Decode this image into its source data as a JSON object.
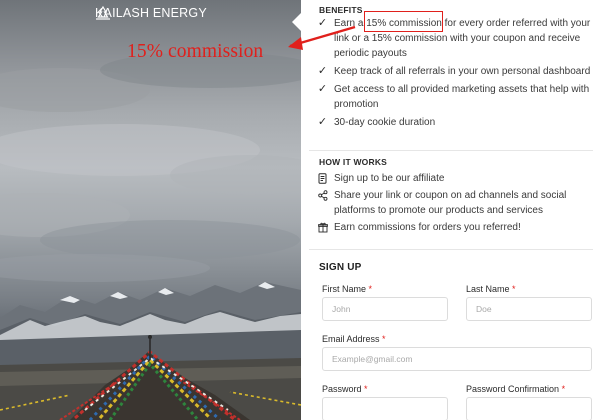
{
  "brand": {
    "name": "KAILASH ENERGY"
  },
  "annotation": {
    "label": "15% commission",
    "color": "#e0201c"
  },
  "benefits": {
    "heading": "BENEFITS",
    "items": [
      {
        "icon": "checkmark-icon",
        "line1_prefix": "Earn a ",
        "line1_highlight": "15% commission",
        "line1_suffix": " for every order referred with",
        "rest": "your link or a 15% commission with your coupon and receive periodic payouts"
      },
      {
        "icon": "checkmark-icon",
        "text": "Keep track of all referrals in your own personal dashboard"
      },
      {
        "icon": "checkmark-icon",
        "text": "Get access to all provided marketing assets that help with promotion"
      },
      {
        "icon": "checkmark-icon",
        "text": "30-day cookie duration"
      }
    ]
  },
  "how_it_works": {
    "heading": "HOW IT WORKS",
    "items": [
      {
        "icon": "signup-form-icon",
        "text": "Sign up to be our affiliate"
      },
      {
        "icon": "share-icon",
        "text": "Share your link or coupon on ad channels and social platforms to promote our products and services"
      },
      {
        "icon": "gift-icon",
        "text": "Earn commissions for orders you referred!"
      }
    ]
  },
  "signup": {
    "heading": "SIGN UP",
    "first_name": {
      "label": "First Name",
      "placeholder": "John"
    },
    "last_name": {
      "label": "Last Name",
      "placeholder": "Doe"
    },
    "email": {
      "label": "Email Address",
      "placeholder": "Example@gmail.com"
    },
    "password": {
      "label": "Password"
    },
    "password_confirmation": {
      "label": "Password Confirmation"
    },
    "required_mark": "*"
  }
}
